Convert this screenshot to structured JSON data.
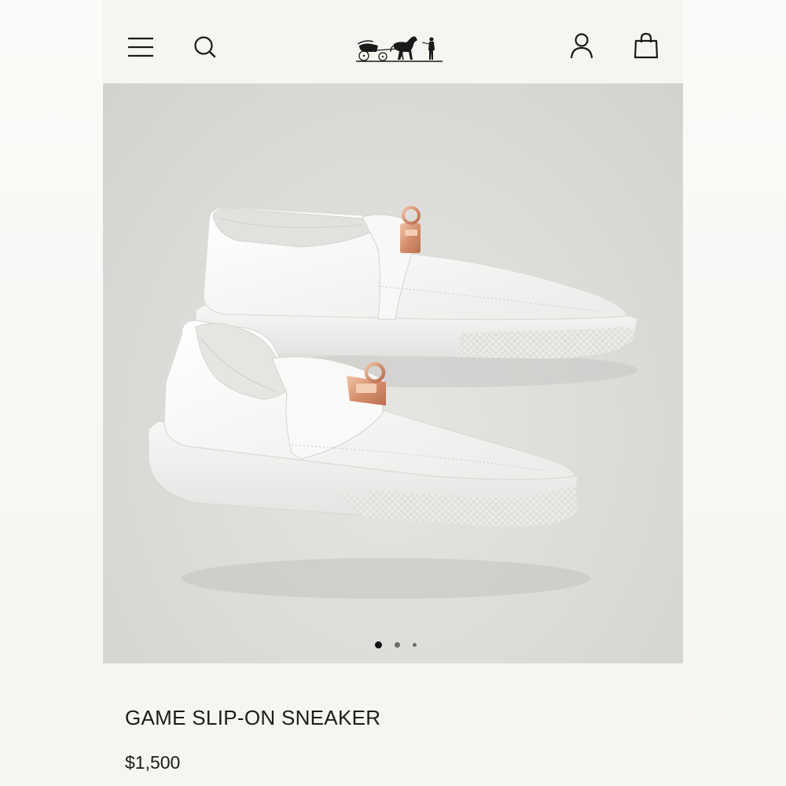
{
  "header": {
    "menu_icon": "hamburger-menu-icon",
    "search_icon": "search-icon",
    "logo_icon": "horse-carriage-logo",
    "account_icon": "user-account-icon",
    "bag_icon": "shopping-bag-icon"
  },
  "gallery": {
    "image_alt": "white leather slip-on sneakers with rose gold Kelly buckle",
    "current_slide": 1,
    "total_slides": 3
  },
  "product": {
    "name": "GAME SLIP-ON SNEAKER",
    "price": "$1,500"
  },
  "colors": {
    "page_bg": "#f7f5f0",
    "image_bg": "#dddbd8",
    "text": "#1c1c1c",
    "accent_hardware": "#d89a7c"
  }
}
